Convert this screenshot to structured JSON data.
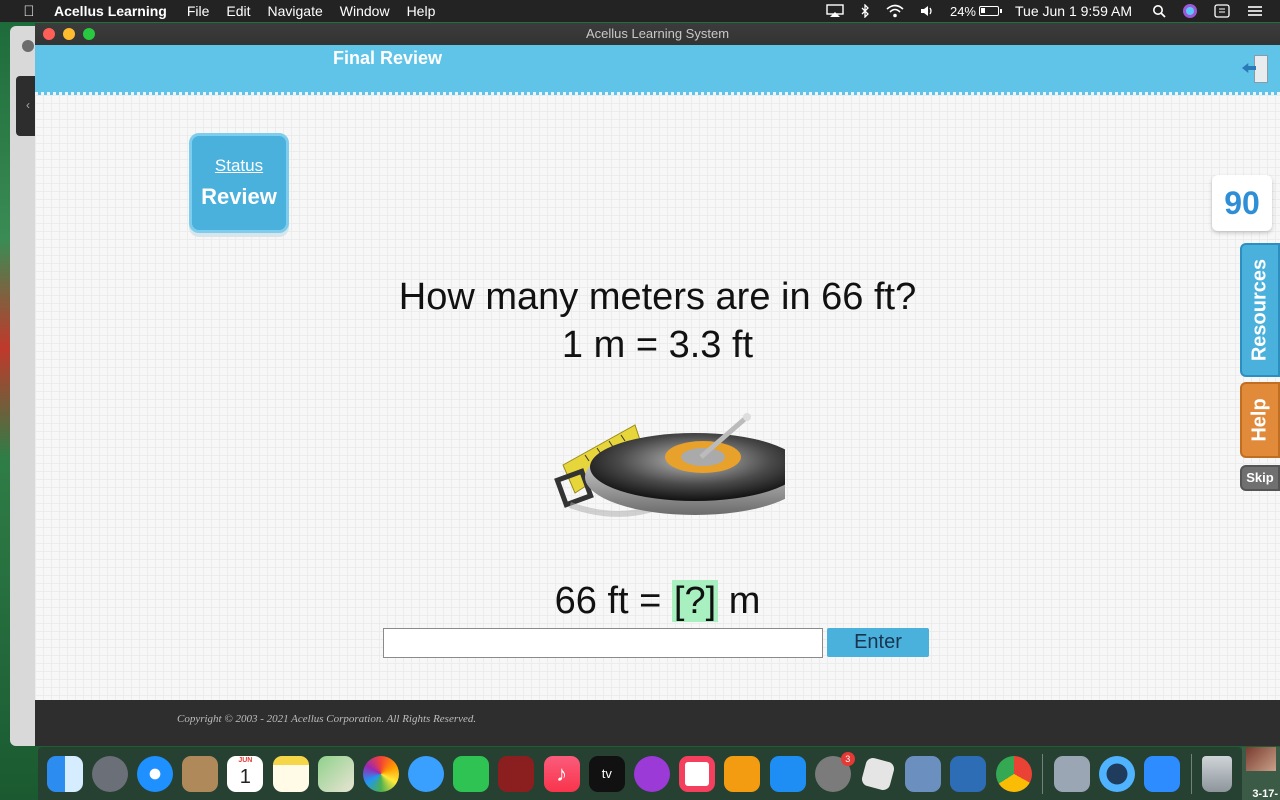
{
  "menubar": {
    "app_name": "Acellus Learning",
    "menus": [
      "File",
      "Edit",
      "Navigate",
      "Window",
      "Help"
    ],
    "battery": "24%",
    "clock": "Tue Jun 1  9:59 AM"
  },
  "window": {
    "title": "Acellus Learning System"
  },
  "header": {
    "title": "Final Review"
  },
  "status_card": {
    "status_link": "Status",
    "mode": "Review"
  },
  "question": {
    "line1": "How many meters are in 66 ft?",
    "line2": "1 m = 3.3 ft"
  },
  "equation": {
    "left": "66 ft = ",
    "blank": "[?]",
    "unit": " m"
  },
  "answer": {
    "value": "",
    "placeholder": "",
    "enter_label": "Enter"
  },
  "sidebar": {
    "score": "90",
    "resources_label": "Resources",
    "help_label": "Help",
    "skip_label": "Skip"
  },
  "footer": {
    "copyright": "Copyright © 2003 - 2021 Acellus Corporation.  All Rights Reserved."
  },
  "dock": {
    "icons": [
      "finder-icon",
      "launchpad-icon",
      "safari-icon",
      "contacts-icon",
      "calendar-icon",
      "notes-icon",
      "maps-icon",
      "photos-icon",
      "messages-icon",
      "facetime-icon",
      "photo-booth-icon",
      "music-icon",
      "apple-tv-icon",
      "podcasts-icon",
      "news-icon",
      "books-icon",
      "app-store-icon",
      "system-preferences-icon",
      "roblox-icon",
      "preview-icon",
      "acellus-icon",
      "chrome-icon",
      "image-capture-icon",
      "quicktime-icon",
      "zoom-icon",
      "trash-icon"
    ],
    "calendar_month": "JUN",
    "calendar_day": "1",
    "sysprefs_badge": "3",
    "tv_label": "tv",
    "desktop_label": "3-17-"
  }
}
